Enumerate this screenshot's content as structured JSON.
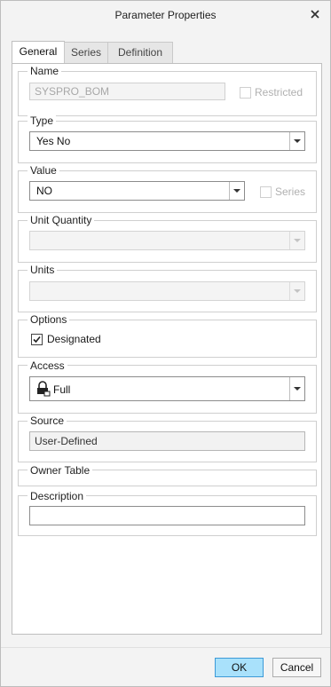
{
  "window": {
    "title": "Parameter Properties"
  },
  "tabs": [
    {
      "label": "General",
      "active": true
    },
    {
      "label": "Series",
      "active": false
    },
    {
      "label": "Definition",
      "active": false
    }
  ],
  "name_group": {
    "legend": "Name",
    "value": "SYSPRO_BOM",
    "restricted_label": "Restricted",
    "restricted_checked": false
  },
  "type_group": {
    "legend": "Type",
    "selected": "Yes No"
  },
  "value_group": {
    "legend": "Value",
    "selected": "NO",
    "series_label": "Series",
    "series_checked": false
  },
  "unit_quantity_group": {
    "legend": "Unit Quantity",
    "selected": ""
  },
  "units_group": {
    "legend": "Units",
    "selected": ""
  },
  "options_group": {
    "legend": "Options",
    "designated_label": "Designated",
    "designated_checked": true
  },
  "access_group": {
    "legend": "Access",
    "selected": "Full",
    "icon": "lock-icon"
  },
  "source_group": {
    "legend": "Source",
    "value": "User-Defined"
  },
  "owner_table_group": {
    "legend": "Owner Table"
  },
  "description_group": {
    "legend": "Description",
    "value": ""
  },
  "footer": {
    "ok_label": "OK",
    "cancel_label": "Cancel"
  },
  "colors": {
    "primary_button": "#a9e1fb",
    "primary_border": "#3c9ad7"
  }
}
